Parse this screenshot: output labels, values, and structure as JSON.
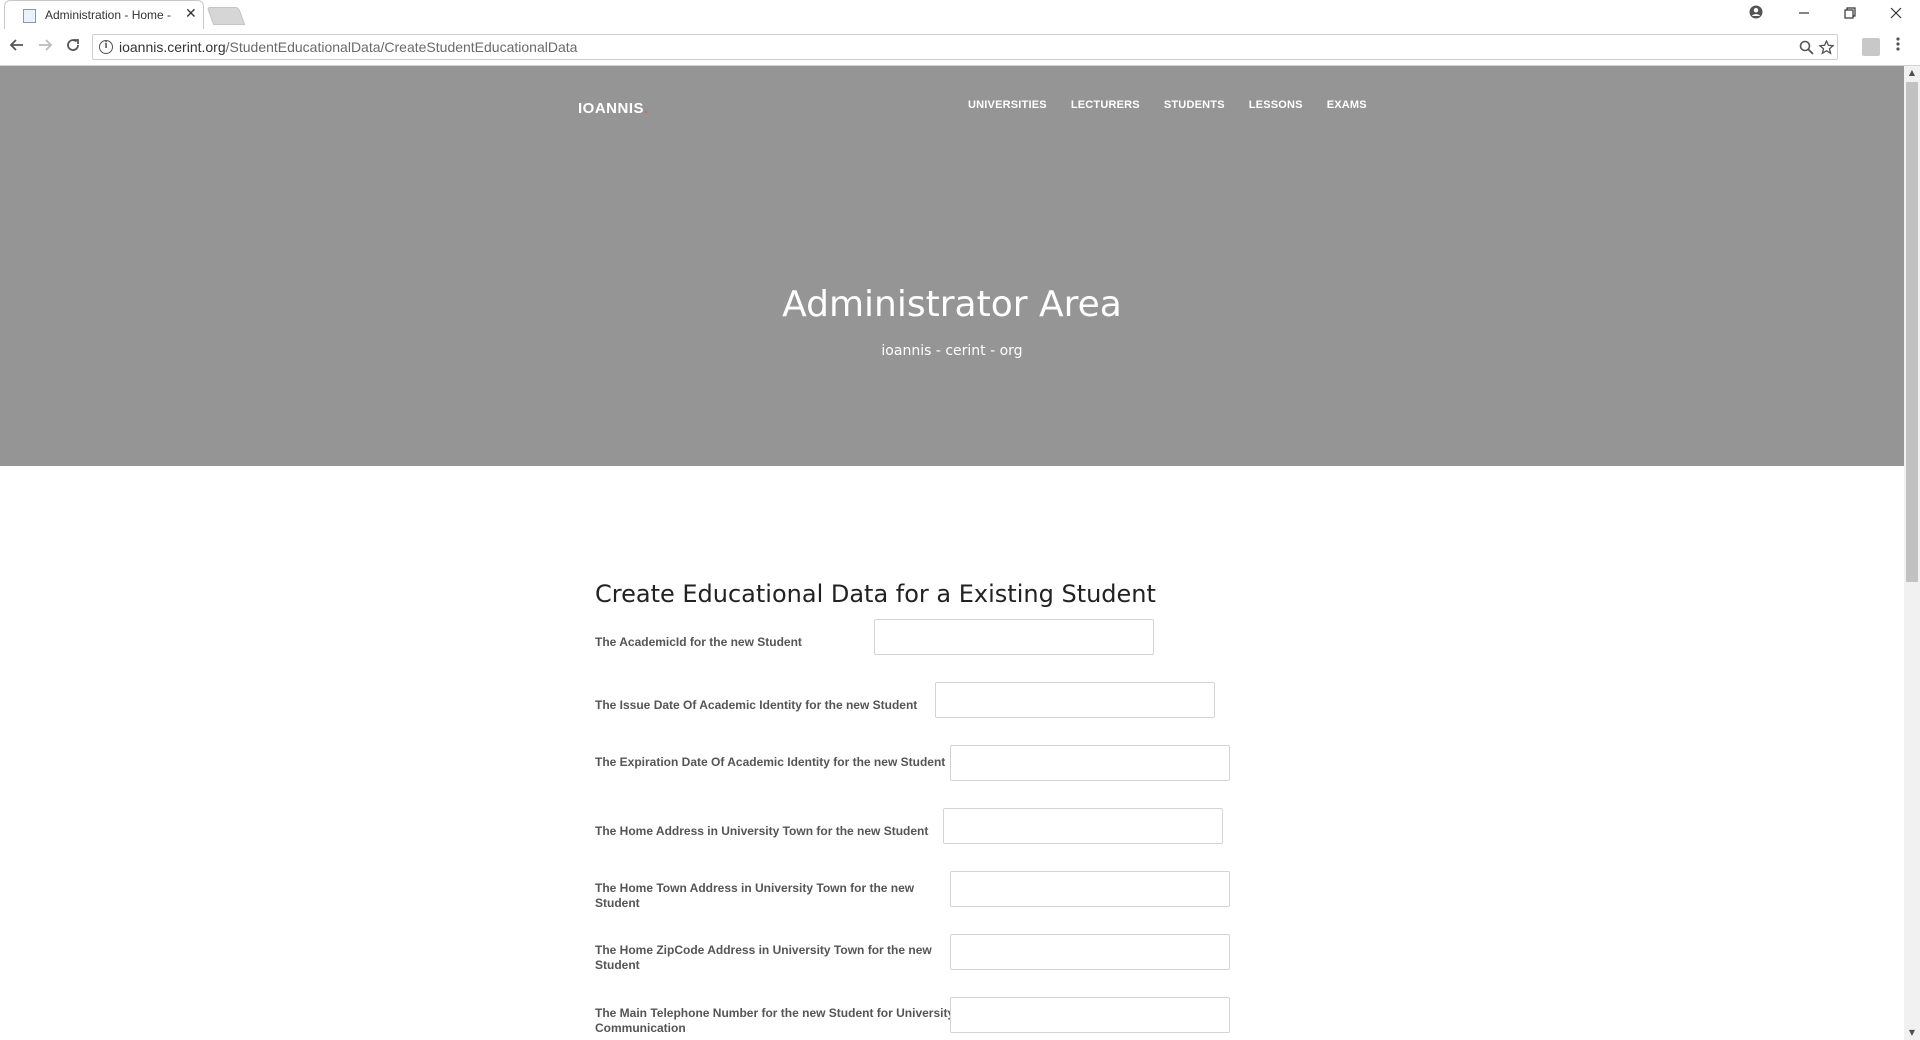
{
  "browser": {
    "tab_title": "Administration - Home -",
    "tab_close": "✕",
    "url_host": "ioannis.cerint.org",
    "url_path": "/StudentEducationalData/CreateStudentEducationalData"
  },
  "site": {
    "brand": "IOANNIS",
    "brand_dot": ".",
    "nav": [
      "UNIVERSITIES",
      "LECTURERS",
      "STUDENTS",
      "LESSONS",
      "EXAMS"
    ]
  },
  "hero": {
    "title": "Administrator Area",
    "subtitle": "ioannis - cerint - org"
  },
  "form": {
    "title": "Create Educational Data for a Existing Student",
    "fields": [
      {
        "label": "The AcademicId for the new Student",
        "value": ""
      },
      {
        "label": "The Issue Date Of Academic Identity for the new Student",
        "value": ""
      },
      {
        "label": "The Expiration Date Of Academic Identity for the new Student",
        "value": ""
      },
      {
        "label": "The Home Address in University Town for the new Student",
        "value": ""
      },
      {
        "label": "The Home Town Address in University Town for the new Student",
        "value": ""
      },
      {
        "label": "The Home ZipCode Address in University Town for the new Student",
        "value": ""
      },
      {
        "label": "The Main Telephone Number for the new Student for University Communication",
        "value": ""
      }
    ]
  },
  "colors": {
    "hero_bg": "#959595",
    "brand_accent": "#f05f40"
  }
}
